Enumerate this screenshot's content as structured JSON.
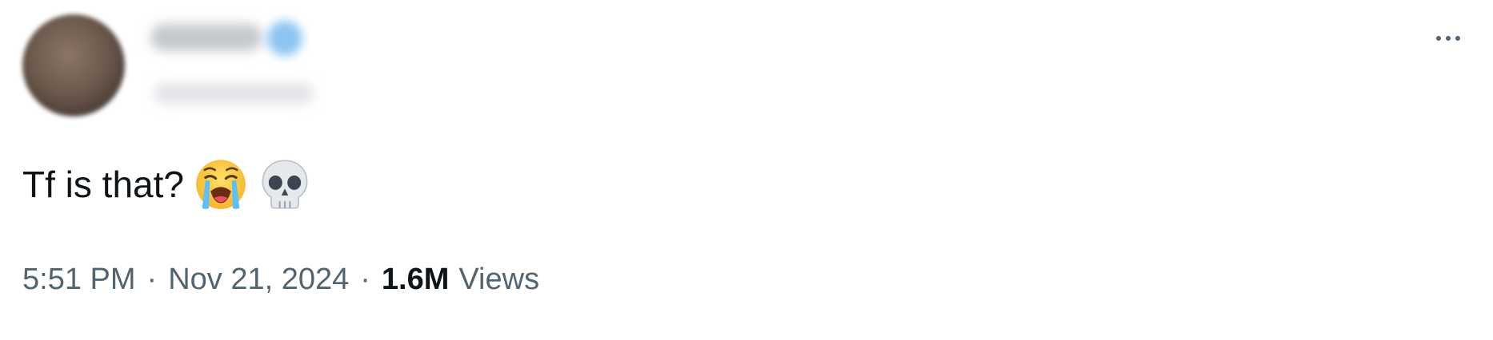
{
  "tweet": {
    "text": "Tf is that?",
    "emojis": [
      "loudly-crying-face-emoji",
      "skull-emoji"
    ],
    "more_icon": "more-horizontal-icon",
    "time": "5:51 PM",
    "separator": "·",
    "date": "Nov 21, 2024",
    "views_count": "1.6M",
    "views_label": "Views"
  },
  "colors": {
    "text_primary": "#0f1419",
    "text_secondary": "#536471",
    "verified_blue": "#1d9bf0",
    "background": "#ffffff"
  }
}
